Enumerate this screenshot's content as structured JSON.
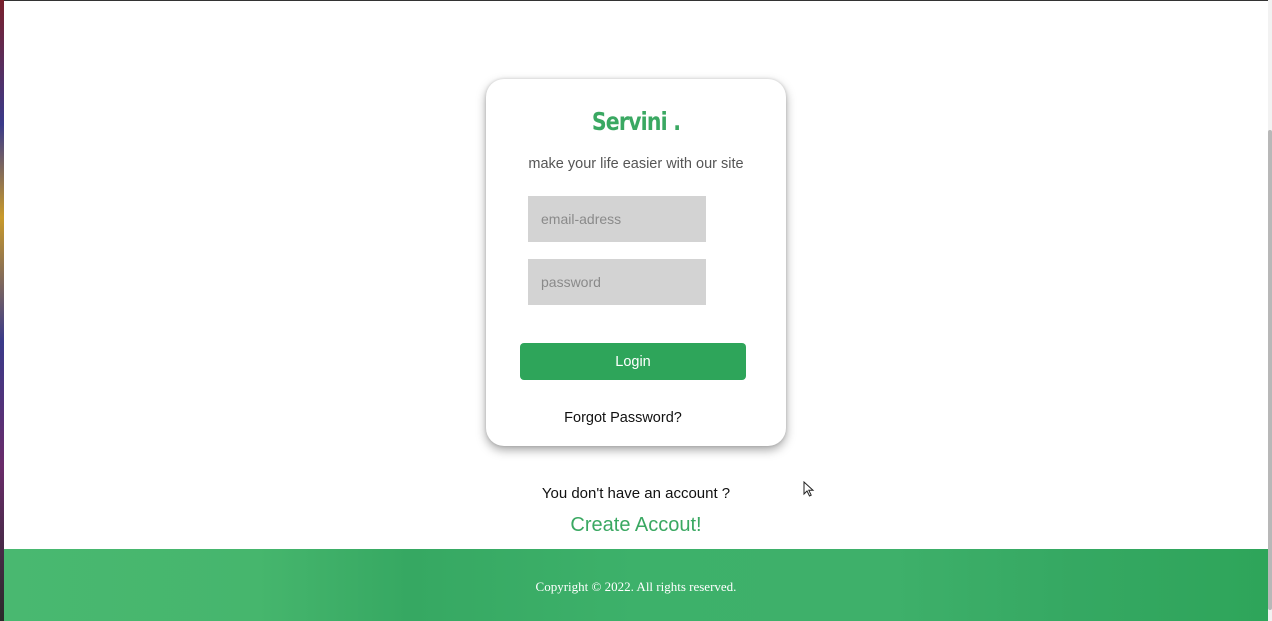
{
  "brand": {
    "name": "Servini .",
    "tagline": "make your life easier with our site"
  },
  "login_form": {
    "email_placeholder": "email-adress",
    "password_placeholder": "password",
    "login_label": "Login",
    "forgot_label": "Forgot Password?"
  },
  "signup": {
    "prompt": "You don't have an account ?",
    "link_label": "Create Accout!"
  },
  "footer": {
    "copyright": "Copyright © 2022. All rights reserved."
  },
  "colors": {
    "accent": "#2ea55a",
    "brand_text": "#3aa862",
    "field_bg": "#d3d3d3"
  },
  "icons": {
    "cursor": "mouse-pointer-icon"
  }
}
